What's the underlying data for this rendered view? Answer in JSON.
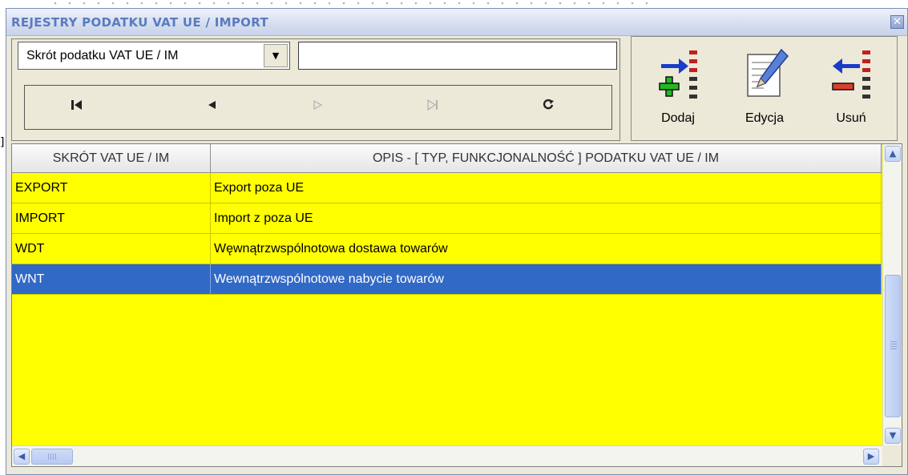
{
  "window": {
    "title": "REJESTRY PODATKU VAT UE / IMPORT",
    "close_symbol": "✕"
  },
  "filter": {
    "field_label": "Skrót podatku VAT UE / IM",
    "search_value": ""
  },
  "navigation": {
    "first": "⏮",
    "prev": "◀",
    "next": "▷",
    "last": "⏭",
    "refresh": "↻"
  },
  "actions": {
    "add_label": "Dodaj",
    "edit_label": "Edycja",
    "delete_label": "Usuń"
  },
  "table": {
    "columns": [
      "SKRÓT VAT UE / IM",
      "OPIS - [ TYP, FUNKCJONALNOŚĆ ] PODATKU VAT UE / IM"
    ],
    "rows": [
      [
        "EXPORT",
        "Export poza UE"
      ],
      [
        "IMPORT",
        "Import z poza UE"
      ],
      [
        "WDT",
        "Węwnątrzwspólnotowa dostawa towarów"
      ],
      [
        "WNT",
        "Wewnątrzwspólnotowe nabycie towarów"
      ]
    ],
    "selected_row": 3,
    "row_color": "#ffff00",
    "selected_color": "#3169c6"
  }
}
